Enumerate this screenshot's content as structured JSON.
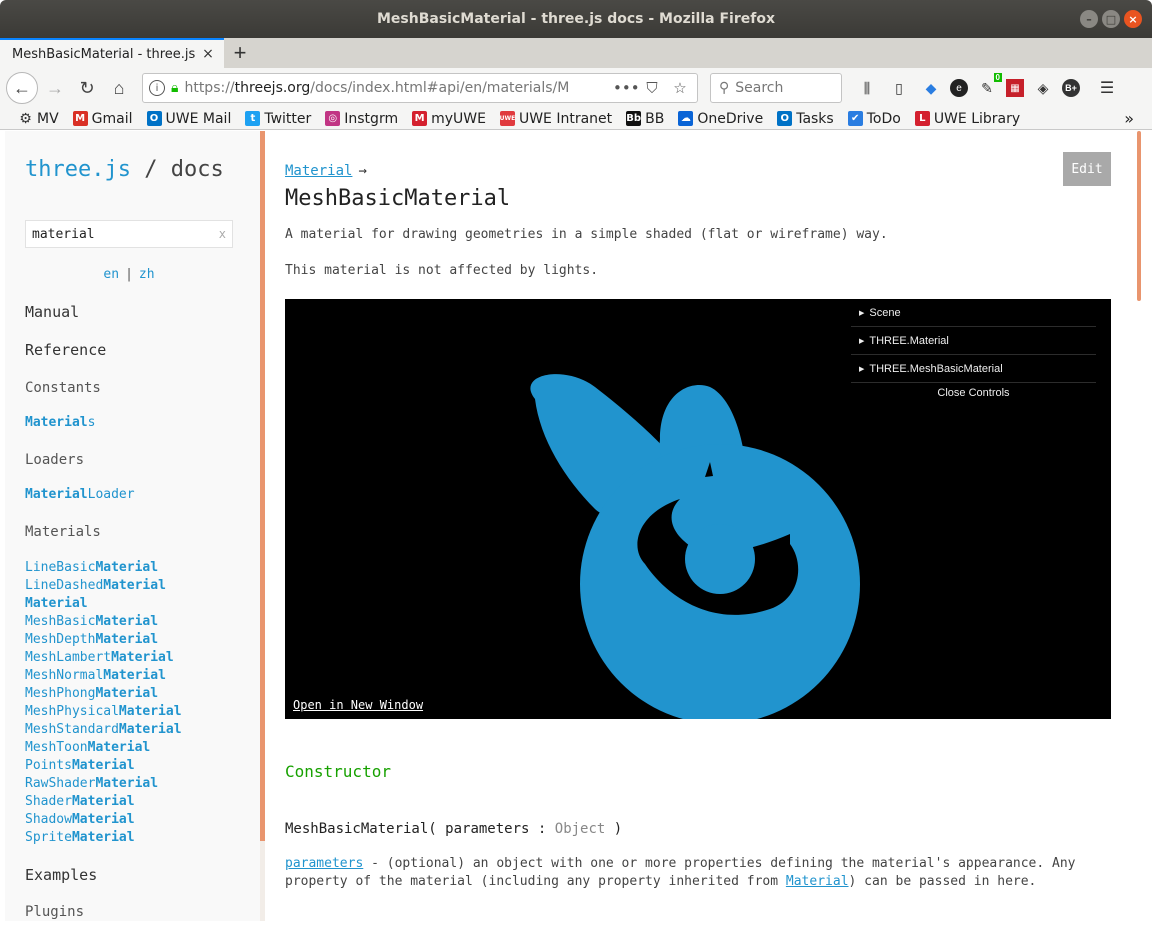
{
  "window": {
    "title": "MeshBasicMaterial - three.js docs - Mozilla Firefox",
    "controls": {
      "minimize": "–",
      "maximize": "□",
      "close": "×"
    }
  },
  "tab": {
    "label": "MeshBasicMaterial - three.js",
    "close": "×",
    "new_tab": "+"
  },
  "navbar": {
    "url_host_prefix": "https://",
    "url_host": "threejs.org",
    "url_path": "/docs/index.html#api/en/materials/M",
    "page_actions": "•••",
    "search_placeholder": "Search"
  },
  "bookmarks": [
    {
      "label": "MV",
      "icon": "gear-icon"
    },
    {
      "label": "Gmail",
      "icon": "gmail-icon",
      "color": "#d93025",
      "glyph": "M"
    },
    {
      "label": "UWE Mail",
      "icon": "outlook-icon",
      "color": "#0072c6",
      "glyph": "O"
    },
    {
      "label": "Twitter",
      "icon": "twitter-icon",
      "color": "#1da1f2",
      "glyph": "t"
    },
    {
      "label": "Instgrm",
      "icon": "instagram-icon",
      "color": "#c13584",
      "glyph": "◎"
    },
    {
      "label": "myUWE",
      "icon": "myuwe-icon",
      "color": "#d4202e",
      "glyph": "M"
    },
    {
      "label": "UWE Intranet",
      "icon": "uwe-icon",
      "color": "#e03a3e",
      "glyph": "UWE"
    },
    {
      "label": "BB",
      "icon": "blackboard-icon",
      "color": "#111111",
      "glyph": "Bb"
    },
    {
      "label": "OneDrive",
      "icon": "onedrive-icon",
      "color": "#0a64d6",
      "glyph": "☁"
    },
    {
      "label": "Tasks",
      "icon": "tasks-icon",
      "color": "#0072c6",
      "glyph": "O"
    },
    {
      "label": "ToDo",
      "icon": "todo-icon",
      "color": "#2a7de1",
      "glyph": "✔"
    },
    {
      "label": "UWE Library",
      "icon": "library-icon",
      "color": "#d4202e",
      "glyph": "L"
    }
  ],
  "extension_badge": "0",
  "extension_label": "B+",
  "sidebar": {
    "logo_site": "three.js",
    "logo_sep": "/",
    "logo_docs": "docs",
    "filter_value": "material",
    "filter_clear": "x",
    "lang_en": "en",
    "lang_sep": "|",
    "lang_zh": "zh",
    "manual": "Manual",
    "reference": "Reference",
    "constants": "Constants",
    "constants_link": {
      "bold": "Material",
      "rest": "s"
    },
    "loaders": "Loaders",
    "loaders_link": {
      "bold": "Material",
      "rest": "Loader"
    },
    "materials": "Materials",
    "material_items": [
      {
        "pre": "LineBasic",
        "bold": "Material"
      },
      {
        "pre": "LineDashed",
        "bold": "Material"
      },
      {
        "pre": "",
        "bold": "Material"
      },
      {
        "pre": "MeshBasic",
        "bold": "Material"
      },
      {
        "pre": "MeshDepth",
        "bold": "Material"
      },
      {
        "pre": "MeshLambert",
        "bold": "Material"
      },
      {
        "pre": "MeshNormal",
        "bold": "Material"
      },
      {
        "pre": "MeshPhong",
        "bold": "Material"
      },
      {
        "pre": "MeshPhysical",
        "bold": "Material"
      },
      {
        "pre": "MeshStandard",
        "bold": "Material"
      },
      {
        "pre": "MeshToon",
        "bold": "Material"
      },
      {
        "pre": "Points",
        "bold": "Material"
      },
      {
        "pre": "RawShader",
        "bold": "Material"
      },
      {
        "pre": "Shader",
        "bold": "Material"
      },
      {
        "pre": "Shadow",
        "bold": "Material"
      },
      {
        "pre": "Sprite",
        "bold": "Material"
      }
    ],
    "examples": "Examples",
    "plugins": "Plugins"
  },
  "main": {
    "breadcrumb_link": "Material",
    "breadcrumb_arrow": "→",
    "title": "MeshBasicMaterial",
    "edit": "Edit",
    "desc1": "A material for drawing geometries in a simple shaded (flat or wireframe) way.",
    "desc2": "This material is not affected by lights.",
    "viewer": {
      "gui_items": [
        "Scene",
        "THREE.Material",
        "THREE.MeshBasicMaterial"
      ],
      "close_controls": "Close Controls",
      "open_window": "Open in New Window",
      "mesh_color": "#2194ce"
    },
    "constructor_heading": "Constructor",
    "ctor_name": "MeshBasicMaterial(",
    "ctor_param": "parameters",
    "ctor_colon": ":",
    "ctor_type": "Object",
    "ctor_close": ")",
    "param_link": "parameters",
    "param_text1": " - (optional) an object with one or more properties defining the material's appearance. Any property of the material (including any property inherited from ",
    "param_link2": "Material",
    "param_text2": ") can be passed in here."
  },
  "colors": {
    "accent": "#2194ce",
    "sidebar_border": "#e9956e",
    "constructor_heading": "#17a100"
  }
}
